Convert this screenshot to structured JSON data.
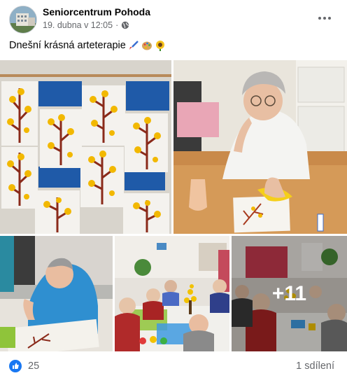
{
  "post": {
    "page_name": "Seniorcentrum Pohoda",
    "date": "19. dubna v 12:05",
    "date_separator": "·",
    "text": "Dnešní krásná arteterapie",
    "emojis": [
      "paintbrush-emoji",
      "palette-emoji",
      "sunflower-emoji"
    ],
    "more_photos": "+11"
  },
  "footer": {
    "likes": "25",
    "shares": "1 sdílení"
  },
  "colors": {
    "text_primary": "#050505",
    "text_secondary": "#65676b",
    "like_blue": "#1877f2"
  }
}
